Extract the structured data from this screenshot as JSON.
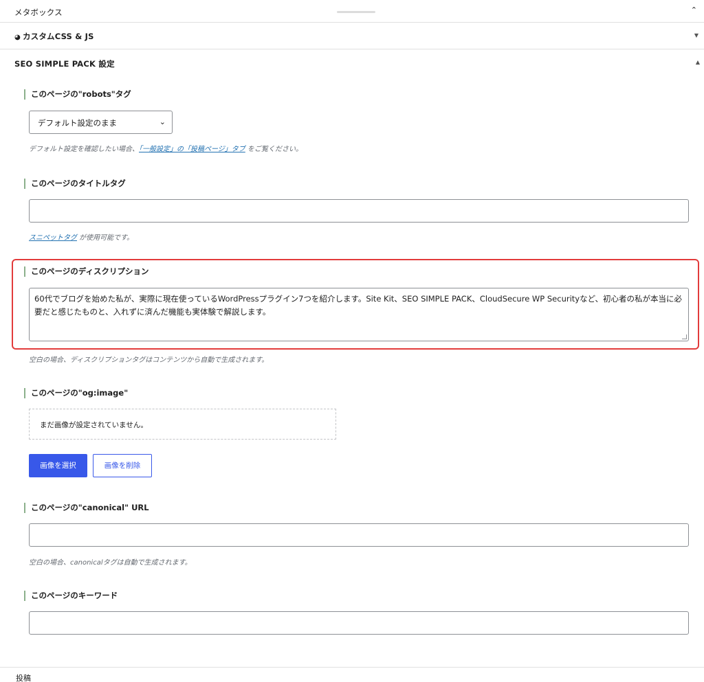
{
  "metabox": {
    "label": "メタボックス"
  },
  "custom_css_js": {
    "label": "カスタムCSS & JS"
  },
  "seo": {
    "label": "SEO SIMPLE PACK 設定",
    "robots": {
      "title": "このページの\"robots\"タグ",
      "selected": "デフォルト設定のまま",
      "help_prefix": "デフォルト設定を確認したい場合、",
      "help_link": "「一般設定」の「投稿ページ」タブ",
      "help_suffix": " をご覧ください。"
    },
    "title_tag": {
      "title": "このページのタイトルタグ",
      "value": "",
      "help_link": "スニペットタグ",
      "help_suffix": " が使用可能です。"
    },
    "description": {
      "title": "このページのディスクリプション",
      "value": "60代でブログを始めた私が、実際に現在使っているWordPressプラグイン7つを紹介します。Site Kit、SEO SIMPLE PACK、CloudSecure WP Securityなど、初心者の私が本当に必要だと感じたものと、入れずに済んだ機能も実体験で解説します。",
      "help": "空白の場合、ディスクリプションタグはコンテンツから自動で生成されます。"
    },
    "og_image": {
      "title": "このページの\"og:image\"",
      "empty_text": "まだ画像が設定されていません。",
      "select_button": "画像を選択",
      "delete_button": "画像を削除"
    },
    "canonical": {
      "title": "このページの\"canonical\" URL",
      "value": "",
      "help": "空白の場合、canonicalタグは自動で生成されます。"
    },
    "keywords": {
      "title": "このページのキーワード",
      "value": ""
    }
  },
  "footer": {
    "label": "投稿"
  },
  "colors": {
    "accent": "#3858e9",
    "highlight": "#e23b3b",
    "link": "#2271b1"
  }
}
